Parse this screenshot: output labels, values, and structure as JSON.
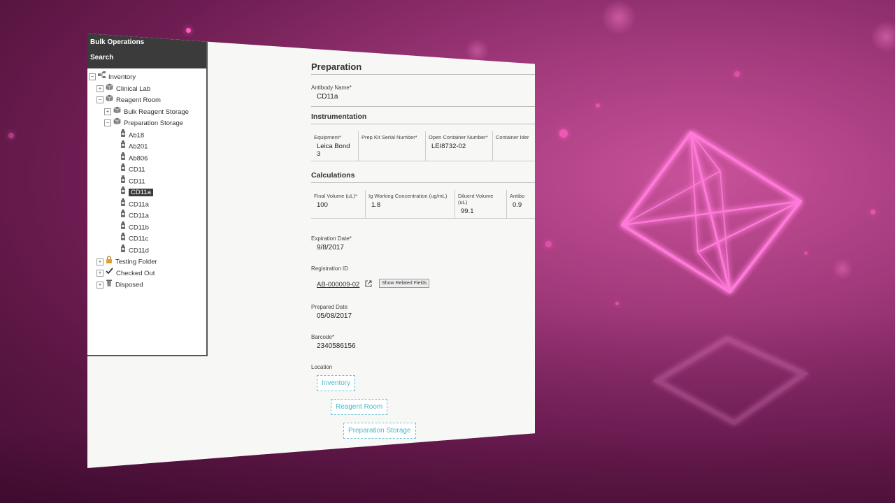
{
  "left_panel": {
    "header": [
      "Bulk Operations",
      "Search"
    ],
    "tree": [
      {
        "label": "Inventory",
        "level": 0,
        "icon": "network-icon",
        "expander": "−"
      },
      {
        "label": "Clinical Lab",
        "level": 1,
        "icon": "box-icon",
        "expander": "+"
      },
      {
        "label": "Reagent Room",
        "level": 1,
        "icon": "box-icon",
        "expander": "−"
      },
      {
        "label": "Bulk Reagent Storage",
        "level": 2,
        "icon": "box-icon",
        "expander": "+"
      },
      {
        "label": "Preparation Storage",
        "level": 2,
        "icon": "box-icon",
        "expander": "−"
      },
      {
        "label": "Ab18",
        "level": 3,
        "icon": "bottle-icon"
      },
      {
        "label": "Ab201",
        "level": 3,
        "icon": "bottle-icon"
      },
      {
        "label": "Ab806",
        "level": 3,
        "icon": "bottle-icon"
      },
      {
        "label": "CD11",
        "level": 3,
        "icon": "bottle-icon"
      },
      {
        "label": "CD11",
        "level": 3,
        "icon": "bottle-icon"
      },
      {
        "label": "CD11a",
        "level": 3,
        "icon": "bottle-icon",
        "selected": true
      },
      {
        "label": "CD11a",
        "level": 3,
        "icon": "bottle-icon"
      },
      {
        "label": "CD11a",
        "level": 3,
        "icon": "bottle-icon"
      },
      {
        "label": "CD11b",
        "level": 3,
        "icon": "bottle-icon"
      },
      {
        "label": "CD11c",
        "level": 3,
        "icon": "bottle-icon"
      },
      {
        "label": "CD11d",
        "level": 3,
        "icon": "bottle-icon"
      },
      {
        "label": "Testing Folder",
        "level": 1,
        "icon": "lock-icon",
        "expander": "+"
      },
      {
        "label": "Checked Out",
        "level": 1,
        "icon": "check-icon",
        "expander": "+"
      },
      {
        "label": "Disposed",
        "level": 1,
        "icon": "trash-icon",
        "expander": "+"
      }
    ]
  },
  "form": {
    "title": "Preparation",
    "antibody": {
      "label": "Antibody Name*",
      "value": "CD11a"
    },
    "instrumentation": {
      "title": "Instrumentation",
      "columns": [
        {
          "label": "Equipment*",
          "value": "Leica Bond 3"
        },
        {
          "label": "Prep Kit Serial Number*",
          "value": ""
        },
        {
          "label": "Open Container Number*",
          "value": "LEI8732-02"
        },
        {
          "label": "Container Ider",
          "value": ""
        }
      ]
    },
    "calculations": {
      "title": "Calculations",
      "columns": [
        {
          "label": "Final Volume (uL)*",
          "value": "100"
        },
        {
          "label": "Ig Working Concentration (ug/mL)",
          "value": "1.8"
        },
        {
          "label": "Diluent Volume (uL)",
          "value": "99.1"
        },
        {
          "label": "Antibo",
          "value": "0.9"
        }
      ]
    },
    "expiration": {
      "label": "Expiration Date*",
      "value": "9/8/2017"
    },
    "registration": {
      "label": "Registration ID",
      "value": "AB-000009-02",
      "button": "Show Related Fields"
    },
    "prepared": {
      "label": "Prepared Date",
      "value": "05/08/2017"
    },
    "barcode": {
      "label": "Barcode*",
      "value": "2340586156"
    },
    "location": {
      "label": "Location",
      "path": [
        "Inventory",
        "Reagent Room",
        "Preparation Storage"
      ]
    }
  },
  "colors": {
    "accent": "#ff5cc0",
    "selection": "#3b3b3b",
    "location_link": "#4fb7c9"
  }
}
